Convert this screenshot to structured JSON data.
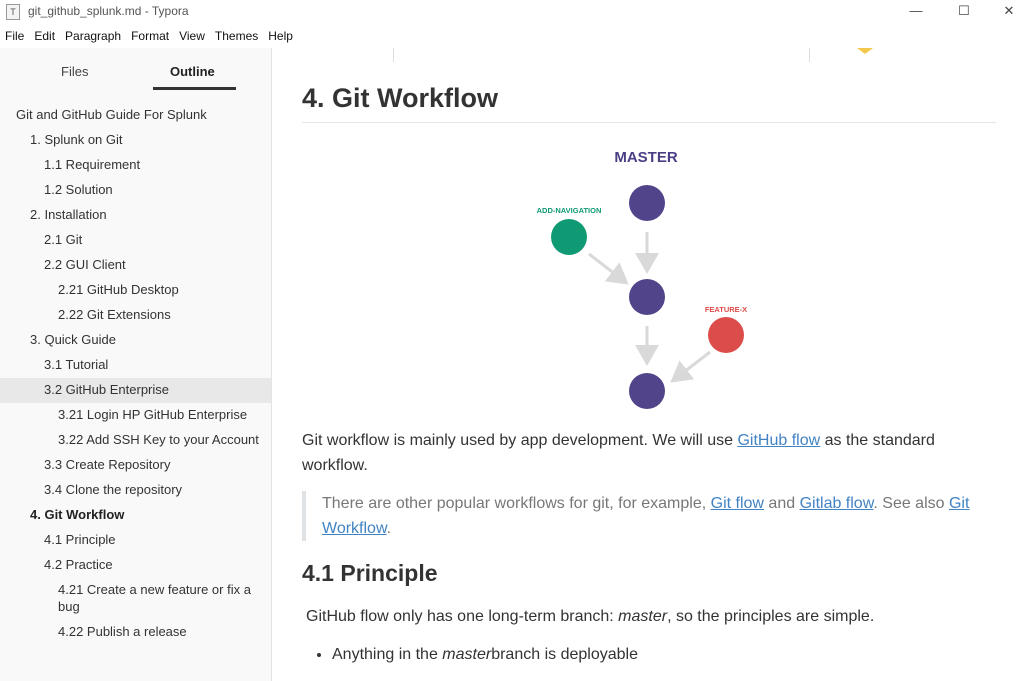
{
  "window": {
    "title": "git_github_splunk.md - Typora",
    "app_icon": "T",
    "controls": {
      "minimize": "—",
      "maximize": "☐",
      "close": "✕"
    }
  },
  "menu": [
    "File",
    "Edit",
    "Paragraph",
    "Format",
    "View",
    "Themes",
    "Help"
  ],
  "sidebar": {
    "tabs": {
      "files": "Files",
      "outline": "Outline",
      "active": "Outline"
    },
    "outline": [
      {
        "label": "Git and GitHub Guide For Splunk",
        "level": 0
      },
      {
        "label": "1. Splunk on Git",
        "level": 1
      },
      {
        "label": "1.1 Requirement",
        "level": 2
      },
      {
        "label": "1.2 Solution",
        "level": 2
      },
      {
        "label": "2. Installation",
        "level": 1
      },
      {
        "label": "2.1 Git",
        "level": 2
      },
      {
        "label": "2.2 GUI Client",
        "level": 2
      },
      {
        "label": "2.21 GitHub Desktop",
        "level": 3
      },
      {
        "label": "2.22 Git Extensions",
        "level": 3
      },
      {
        "label": "3. Quick Guide",
        "level": 1
      },
      {
        "label": "3.1 Tutorial",
        "level": 2
      },
      {
        "label": "3.2 GitHub Enterprise",
        "level": 2,
        "active": true
      },
      {
        "label": "3.21 Login HP GitHub Enterprise",
        "level": 3
      },
      {
        "label": "3.22 Add SSH Key to your Account",
        "level": 3
      },
      {
        "label": "3.3 Create Repository",
        "level": 2
      },
      {
        "label": "3.4 Clone the repository",
        "level": 2
      },
      {
        "label": "4. Git Workflow",
        "level": 1,
        "bold": true
      },
      {
        "label": "4.1 Principle",
        "level": 2
      },
      {
        "label": "4.2 Practice",
        "level": 2
      },
      {
        "label": "4.21 Create a new feature or fix a bug",
        "level": 3
      },
      {
        "label": "4.22 Publish a release",
        "level": 3
      }
    ]
  },
  "editor": {
    "heading": "4. Git Workflow",
    "diagram": {
      "title": "MASTER",
      "label_left": "ADD-NAVIGATION",
      "label_right": "FEATURE-X",
      "colors": {
        "master": "#52448a",
        "navigation": "#109a73",
        "feature": "#dc4c4a",
        "arrow": "#d9d9d9",
        "title": "#4a3f85"
      }
    },
    "para1": {
      "before": "Git workflow is mainly used by app development. We will use ",
      "link": "GitHub flow",
      "after": "  as the standard workflow."
    },
    "quote": {
      "t1": "There are other popular workflows for git, for example, ",
      "link1": "Git flow",
      "t2": " and ",
      "link2": "Gitlab flow",
      "t3": ". See also ",
      "link3": "Git Workflow",
      "t4": "."
    },
    "subheading": "4.1 Principle",
    "para2": {
      "before": "GitHub flow only has one long-term branch: ",
      "em": "master",
      "after": ", so the principles are simple."
    },
    "bullet1": {
      "before": "Anything in the ",
      "em": "master",
      "after": "branch is deployable"
    },
    "link_color": "#4183c4"
  }
}
